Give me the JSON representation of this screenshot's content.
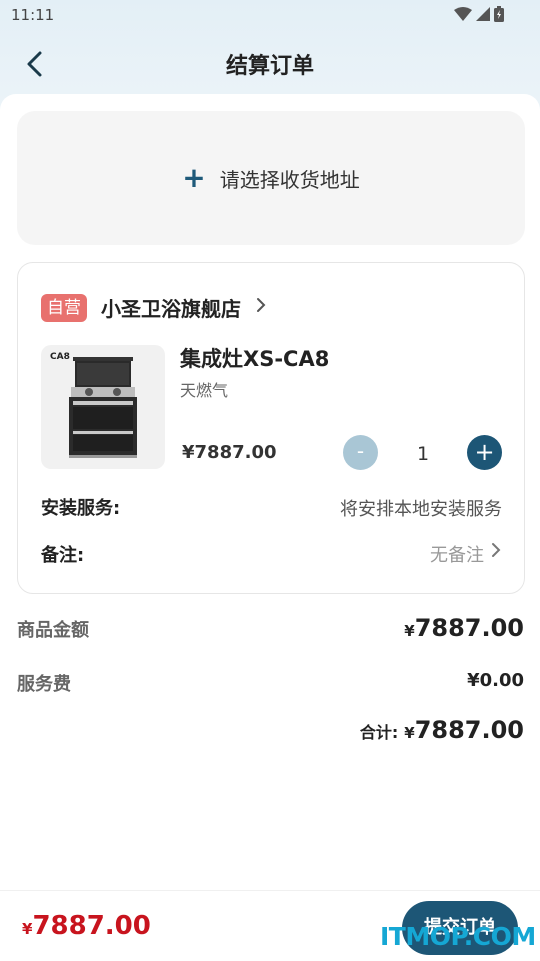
{
  "status_bar": {
    "time": "11:11"
  },
  "header": {
    "title": "结算订单"
  },
  "address": {
    "placeholder_label": "请选择收货地址"
  },
  "store": {
    "badge": "自营",
    "name": "小圣卫浴旗舰店"
  },
  "product": {
    "image_tag": "CA8",
    "name": "集成灶XS-CA8",
    "spec": "天燃气",
    "price": "¥7887.00",
    "quantity": "1",
    "minus_label": "-",
    "plus_label": "+"
  },
  "install": {
    "label": "安装服务:",
    "value": "将安排本地安装服务"
  },
  "remark": {
    "label": "备注:",
    "value": "无备注"
  },
  "summary": {
    "goods_label": "商品金额",
    "goods_currency": "¥",
    "goods_value": "7887.00",
    "service_label": "服务费",
    "service_value": "¥0.00",
    "total_label": "合计:",
    "total_currency": "¥",
    "total_value": "7887.00"
  },
  "bottom": {
    "total_currency": "¥",
    "total_value": "7887.00",
    "submit_label": "提交订单"
  },
  "watermark": "ITMOP.COM",
  "colors": {
    "primary": "#1d5676",
    "accent_red": "#c8141e",
    "badge_red": "#e8716e"
  }
}
